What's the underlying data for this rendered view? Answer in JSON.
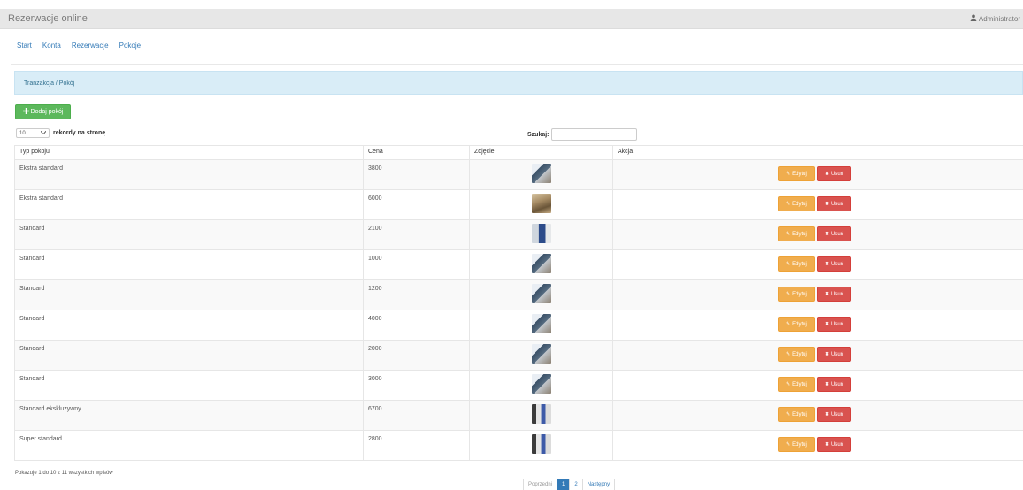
{
  "header": {
    "brand": "Rezerwacje online",
    "user": "Administrator"
  },
  "nav": [
    "Start",
    "Konta",
    "Rezerwacje",
    "Pokoje"
  ],
  "breadcrumb": "Tranzakcja / Pokój",
  "add_button": "Dodaj pokój",
  "length_control": {
    "value": "10",
    "label": "rekordy na stronę"
  },
  "search": {
    "label": "Szukaj:",
    "value": ""
  },
  "table": {
    "columns": [
      "Typ pokoju",
      "Cena",
      "Zdjęcie",
      "Akcja"
    ],
    "rows": [
      {
        "type": "Ekstra standard",
        "price": "3800",
        "photo": "room-photo-bedroom-window"
      },
      {
        "type": "Ekstra standard",
        "price": "6000",
        "photo": "room-photo-hotel-room-warm"
      },
      {
        "type": "Standard",
        "price": "2100",
        "photo": "room-photo-bed-blue"
      },
      {
        "type": "Standard",
        "price": "1000",
        "photo": "room-photo-bedroom-window"
      },
      {
        "type": "Standard",
        "price": "1200",
        "photo": "room-photo-bedroom-window"
      },
      {
        "type": "Standard",
        "price": "4000",
        "photo": "room-photo-bedroom-window"
      },
      {
        "type": "Standard",
        "price": "2000",
        "photo": "room-photo-bedroom-window"
      },
      {
        "type": "Standard",
        "price": "3000",
        "photo": "room-photo-bedroom-window"
      },
      {
        "type": "Standard ekskluzywny",
        "price": "6700",
        "photo": "room-photo-room-curtains"
      },
      {
        "type": "Super standard",
        "price": "2800",
        "photo": "room-photo-room-curtains"
      }
    ]
  },
  "actions": {
    "edit_label": "Edytuj",
    "delete_label": "Usuń"
  },
  "footer": {
    "info": "Pokazuje 1 do 10 z 11 wszystkich wpisów",
    "pagination": {
      "prev": "Poprzedni",
      "pages": [
        "1",
        "2"
      ],
      "active": "1",
      "next": "Następny"
    }
  },
  "colors": {
    "topbar": "#e7e7e7",
    "link": "#337ab7",
    "info_bg": "#d9edf7",
    "success": "#5cb85c",
    "warning": "#f0ad4e",
    "danger": "#d9534f"
  },
  "icons": {
    "user": "user-icon",
    "add": "plus-icon",
    "dropdown": "chevron-down-icon",
    "edit": "edit-icon",
    "delete": "close-icon"
  }
}
